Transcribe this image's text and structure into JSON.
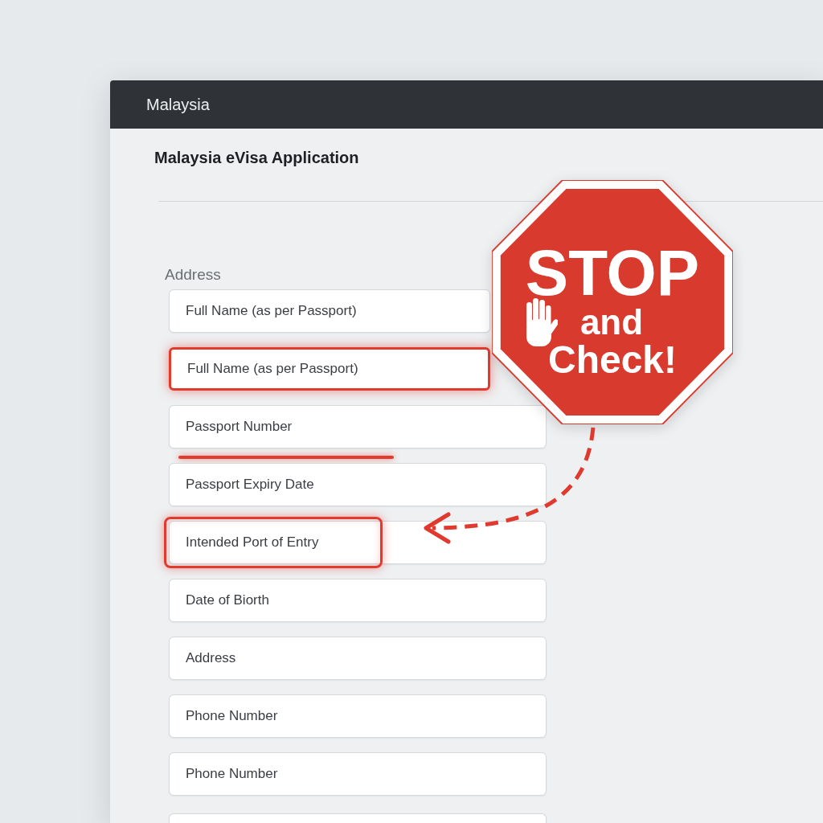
{
  "window": {
    "title": "Malaysia"
  },
  "form": {
    "title": "Malaysia eVisa Application",
    "section_label": "Address",
    "fields": [
      {
        "placeholder": "Full Name (as per Passport)",
        "highlighted": false,
        "underlined": false,
        "label_highlighted": false
      },
      {
        "placeholder": "Full Name (as per Passport)",
        "highlighted": true,
        "underlined": false,
        "label_highlighted": false
      },
      {
        "placeholder": "Passport Number",
        "highlighted": false,
        "underlined": true,
        "label_highlighted": false
      },
      {
        "placeholder": "Passport Expiry Date",
        "highlighted": false,
        "underlined": false,
        "label_highlighted": false
      },
      {
        "placeholder": "Intended Port of Entry",
        "highlighted": false,
        "underlined": false,
        "label_highlighted": true
      },
      {
        "placeholder": "Date of Biorth",
        "highlighted": false,
        "underlined": false,
        "label_highlighted": false
      },
      {
        "placeholder": "Address",
        "highlighted": false,
        "underlined": false,
        "label_highlighted": false
      },
      {
        "placeholder": "Phone Number",
        "highlighted": false,
        "underlined": false,
        "label_highlighted": false
      },
      {
        "placeholder": "Phone Number",
        "highlighted": false,
        "underlined": false,
        "label_highlighted": false
      },
      {
        "highlighted": false,
        "underlined": false,
        "label_highlighted": false
      }
    ]
  },
  "sign": {
    "heading": "STOP",
    "lines": [
      "and",
      "Check!"
    ]
  }
}
